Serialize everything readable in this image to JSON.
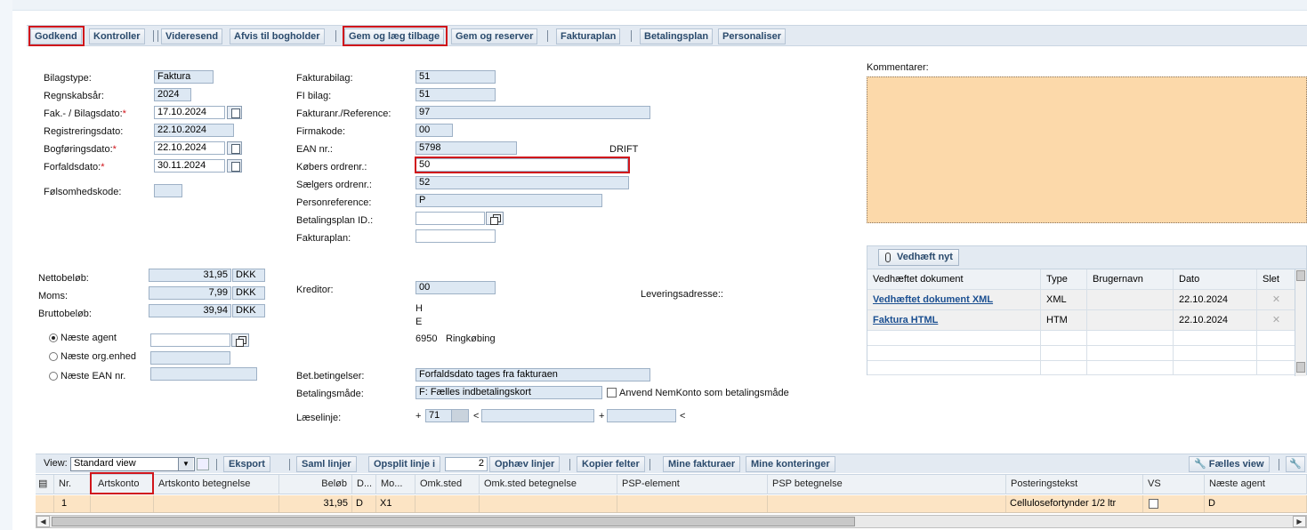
{
  "toolbar": {
    "approve": "Godkend",
    "check": "Kontroller",
    "forward": "Videresend",
    "reject": "Afvis til bogholder",
    "save_return": "Gem og læg tilbage",
    "save_reserve": "Gem og reserver",
    "invoice_plan": "Fakturaplan",
    "payment_plan": "Betalingsplan",
    "personalize": "Personaliser"
  },
  "header": {
    "doc_type": {
      "label": "Bilagstype:",
      "value": "Faktura"
    },
    "fiscal_year": {
      "label": "Regnskabsår:",
      "value": "2024"
    },
    "invoice_date": {
      "label": "Fak.- / Bilagsdato:",
      "value": "17.10.2024"
    },
    "registration_date": {
      "label": "Registreringsdato:",
      "value": "22.10.2024"
    },
    "posting_date": {
      "label": "Bogføringsdato:",
      "value": "22.10.2024"
    },
    "due_date": {
      "label": "Forfaldsdato:",
      "value": "30.11.2024"
    },
    "sensitivity": {
      "label": "Følsomhedskode:",
      "value": ""
    },
    "required_mark": "*"
  },
  "mid": {
    "invoice_doc": {
      "label": "Fakturabilag:",
      "value": "51"
    },
    "fi_doc": {
      "label": "FI bilag:",
      "value": "51"
    },
    "invoice_ref": {
      "label": "Fakturanr./Reference:",
      "value": "97"
    },
    "company_code": {
      "label": "Firmakode:",
      "value": "00"
    },
    "ean": {
      "label": "EAN nr.:",
      "value": "5798",
      "suffix": "DRIFT"
    },
    "buyer_order": {
      "label": "Købers ordrenr.:",
      "value": "50"
    },
    "seller_order": {
      "label": "Sælgers ordrenr.:",
      "value": "52"
    },
    "person_ref": {
      "label": "Personreference:",
      "value": "P"
    },
    "payment_plan_id": {
      "label": "Betalingsplan ID.:",
      "value": ""
    },
    "invoice_plan": {
      "label": "Fakturaplan:",
      "value": ""
    }
  },
  "amounts": {
    "net": {
      "label": "Nettobeløb:",
      "value": "31,95",
      "currency": "DKK"
    },
    "vat": {
      "label": "Moms:",
      "value": "7,99",
      "currency": "DKK"
    },
    "gross": {
      "label": "Bruttobeløb:",
      "value": "39,94",
      "currency": "DKK"
    }
  },
  "routing": {
    "next_agent": "Næste agent",
    "next_org": "Næste org.enhed",
    "next_ean": "Næste EAN nr."
  },
  "creditor": {
    "label": "Kreditor:",
    "value": "00",
    "line1": "H",
    "line2": "E",
    "postal": "6950",
    "city": "Ringkøbing",
    "delivery_label": "Leveringsadresse::"
  },
  "payment": {
    "terms_label": "Bet.betingelser:",
    "terms_value": "Forfaldsdato tages fra fakturaen",
    "method_label": "Betalingsmåde:",
    "method_value": "F: Fælles indbetalingskort",
    "nemkonto_label": "Anvend NemKonto som betalingsmåde",
    "readline_label": "Læselinje:",
    "readline_plus": "+",
    "readline_code": "71",
    "readline_lt": "<",
    "readline_plus2": "+",
    "readline_lt2": "<"
  },
  "comments": {
    "label": "Kommentarer:"
  },
  "attachments": {
    "add_button": "Vedhæft nyt",
    "columns": [
      "Vedhæftet dokument",
      "Type",
      "Brugernavn",
      "Dato",
      "Slet"
    ],
    "rows": [
      {
        "name": "Vedhæftet dokument XML",
        "type": "XML",
        "user": "",
        "date": "22.10.2024"
      },
      {
        "name": "Faktura HTML",
        "type": "HTM",
        "user": "",
        "date": "22.10.2024"
      }
    ]
  },
  "grid": {
    "view_label": "View:",
    "view_value": "Standard view",
    "export": "Eksport",
    "merge_lines": "Saml linjer",
    "split_lines": "Opsplit linje i",
    "split_count": "2",
    "undo_lines": "Ophæv linjer",
    "copy_fields": "Kopier felter",
    "my_invoices": "Mine fakturaer",
    "my_postings": "Mine konteringer",
    "shared_view": "Fælles view",
    "columns": [
      "Nr.",
      "Artskonto",
      "Artskonto betegnelse",
      "Beløb",
      "D...",
      "Mo...",
      "Omk.sted",
      "Omk.sted betegnelse",
      "PSP-element",
      "PSP betegnelse",
      "Posteringstekst",
      "VS",
      "Næste agent"
    ],
    "row": {
      "nr": "1",
      "account": "",
      "account_desc": "",
      "amount": "31,95",
      "d": "D",
      "mo": "X1",
      "cost_center": "",
      "cost_center_desc": "",
      "psp": "",
      "psp_desc": "",
      "text": "Cellulosefortynder 1/2 ltr",
      "next_agent": "D"
    }
  }
}
